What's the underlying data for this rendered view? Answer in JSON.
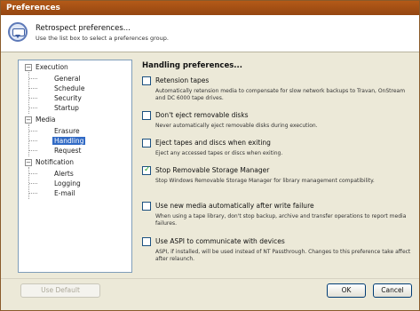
{
  "window": {
    "title": "Preferences"
  },
  "header": {
    "title": "Retrospect preferences...",
    "subtitle": "Use the list box to select a preferences group."
  },
  "tree": {
    "groups": [
      {
        "label": "Execution",
        "toggle": "−",
        "children": [
          "General",
          "Schedule",
          "Security",
          "Startup"
        ]
      },
      {
        "label": "Media",
        "toggle": "−",
        "children": [
          "Erasure",
          "Handling",
          "Request"
        ]
      },
      {
        "label": "Notification",
        "toggle": "−",
        "children": [
          "Alerts",
          "Logging",
          "E-mail"
        ]
      }
    ],
    "selected": "Handling"
  },
  "panel": {
    "title": "Handling preferences...",
    "options": [
      {
        "label": "Retension tapes",
        "checked": false,
        "description": "Automatically retension media to compensate for slow network backups to Travan, OnStream and DC 6000 tape drives."
      },
      {
        "label": "Don't eject removable disks",
        "checked": false,
        "description": "Never automatically eject removable disks during execution."
      },
      {
        "label": "Eject tapes and discs when exiting",
        "checked": false,
        "description": "Eject any accessed tapes or discs when exiting."
      },
      {
        "label": "Stop Removable Storage Manager",
        "checked": true,
        "description": "Stop Windows Removable Storage Manager for library management compatibility."
      },
      {
        "label": "Use new media automatically after write failure",
        "checked": false,
        "description": "When using a tape library, don't stop backup, archive and transfer operations to report media failures."
      },
      {
        "label": "Use ASPI to communicate with devices",
        "checked": false,
        "description": "ASPI, if installed, will be used instead of NT Passthrough. Changes to this preference take affect after relaunch."
      }
    ]
  },
  "buttons": {
    "use_default": "Use Default",
    "ok": "OK",
    "cancel": "Cancel"
  },
  "colors": {
    "titlebar": "#a34f12",
    "selection": "#316ac5",
    "checkmark": "#21a121"
  }
}
